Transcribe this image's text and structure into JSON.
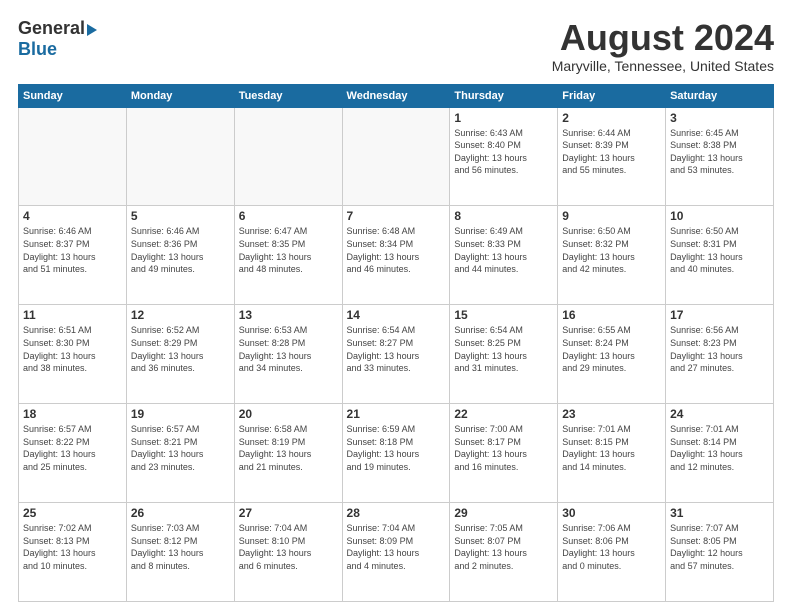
{
  "header": {
    "logo_general": "General",
    "logo_blue": "Blue",
    "title": "August 2024",
    "location": "Maryville, Tennessee, United States"
  },
  "weekdays": [
    "Sunday",
    "Monday",
    "Tuesday",
    "Wednesday",
    "Thursday",
    "Friday",
    "Saturday"
  ],
  "weeks": [
    [
      {
        "day": "",
        "info": ""
      },
      {
        "day": "",
        "info": ""
      },
      {
        "day": "",
        "info": ""
      },
      {
        "day": "",
        "info": ""
      },
      {
        "day": "1",
        "info": "Sunrise: 6:43 AM\nSunset: 8:40 PM\nDaylight: 13 hours\nand 56 minutes."
      },
      {
        "day": "2",
        "info": "Sunrise: 6:44 AM\nSunset: 8:39 PM\nDaylight: 13 hours\nand 55 minutes."
      },
      {
        "day": "3",
        "info": "Sunrise: 6:45 AM\nSunset: 8:38 PM\nDaylight: 13 hours\nand 53 minutes."
      }
    ],
    [
      {
        "day": "4",
        "info": "Sunrise: 6:46 AM\nSunset: 8:37 PM\nDaylight: 13 hours\nand 51 minutes."
      },
      {
        "day": "5",
        "info": "Sunrise: 6:46 AM\nSunset: 8:36 PM\nDaylight: 13 hours\nand 49 minutes."
      },
      {
        "day": "6",
        "info": "Sunrise: 6:47 AM\nSunset: 8:35 PM\nDaylight: 13 hours\nand 48 minutes."
      },
      {
        "day": "7",
        "info": "Sunrise: 6:48 AM\nSunset: 8:34 PM\nDaylight: 13 hours\nand 46 minutes."
      },
      {
        "day": "8",
        "info": "Sunrise: 6:49 AM\nSunset: 8:33 PM\nDaylight: 13 hours\nand 44 minutes."
      },
      {
        "day": "9",
        "info": "Sunrise: 6:50 AM\nSunset: 8:32 PM\nDaylight: 13 hours\nand 42 minutes."
      },
      {
        "day": "10",
        "info": "Sunrise: 6:50 AM\nSunset: 8:31 PM\nDaylight: 13 hours\nand 40 minutes."
      }
    ],
    [
      {
        "day": "11",
        "info": "Sunrise: 6:51 AM\nSunset: 8:30 PM\nDaylight: 13 hours\nand 38 minutes."
      },
      {
        "day": "12",
        "info": "Sunrise: 6:52 AM\nSunset: 8:29 PM\nDaylight: 13 hours\nand 36 minutes."
      },
      {
        "day": "13",
        "info": "Sunrise: 6:53 AM\nSunset: 8:28 PM\nDaylight: 13 hours\nand 34 minutes."
      },
      {
        "day": "14",
        "info": "Sunrise: 6:54 AM\nSunset: 8:27 PM\nDaylight: 13 hours\nand 33 minutes."
      },
      {
        "day": "15",
        "info": "Sunrise: 6:54 AM\nSunset: 8:25 PM\nDaylight: 13 hours\nand 31 minutes."
      },
      {
        "day": "16",
        "info": "Sunrise: 6:55 AM\nSunset: 8:24 PM\nDaylight: 13 hours\nand 29 minutes."
      },
      {
        "day": "17",
        "info": "Sunrise: 6:56 AM\nSunset: 8:23 PM\nDaylight: 13 hours\nand 27 minutes."
      }
    ],
    [
      {
        "day": "18",
        "info": "Sunrise: 6:57 AM\nSunset: 8:22 PM\nDaylight: 13 hours\nand 25 minutes."
      },
      {
        "day": "19",
        "info": "Sunrise: 6:57 AM\nSunset: 8:21 PM\nDaylight: 13 hours\nand 23 minutes."
      },
      {
        "day": "20",
        "info": "Sunrise: 6:58 AM\nSunset: 8:19 PM\nDaylight: 13 hours\nand 21 minutes."
      },
      {
        "day": "21",
        "info": "Sunrise: 6:59 AM\nSunset: 8:18 PM\nDaylight: 13 hours\nand 19 minutes."
      },
      {
        "day": "22",
        "info": "Sunrise: 7:00 AM\nSunset: 8:17 PM\nDaylight: 13 hours\nand 16 minutes."
      },
      {
        "day": "23",
        "info": "Sunrise: 7:01 AM\nSunset: 8:15 PM\nDaylight: 13 hours\nand 14 minutes."
      },
      {
        "day": "24",
        "info": "Sunrise: 7:01 AM\nSunset: 8:14 PM\nDaylight: 13 hours\nand 12 minutes."
      }
    ],
    [
      {
        "day": "25",
        "info": "Sunrise: 7:02 AM\nSunset: 8:13 PM\nDaylight: 13 hours\nand 10 minutes."
      },
      {
        "day": "26",
        "info": "Sunrise: 7:03 AM\nSunset: 8:12 PM\nDaylight: 13 hours\nand 8 minutes."
      },
      {
        "day": "27",
        "info": "Sunrise: 7:04 AM\nSunset: 8:10 PM\nDaylight: 13 hours\nand 6 minutes."
      },
      {
        "day": "28",
        "info": "Sunrise: 7:04 AM\nSunset: 8:09 PM\nDaylight: 13 hours\nand 4 minutes."
      },
      {
        "day": "29",
        "info": "Sunrise: 7:05 AM\nSunset: 8:07 PM\nDaylight: 13 hours\nand 2 minutes."
      },
      {
        "day": "30",
        "info": "Sunrise: 7:06 AM\nSunset: 8:06 PM\nDaylight: 13 hours\nand 0 minutes."
      },
      {
        "day": "31",
        "info": "Sunrise: 7:07 AM\nSunset: 8:05 PM\nDaylight: 12 hours\nand 57 minutes."
      }
    ]
  ]
}
